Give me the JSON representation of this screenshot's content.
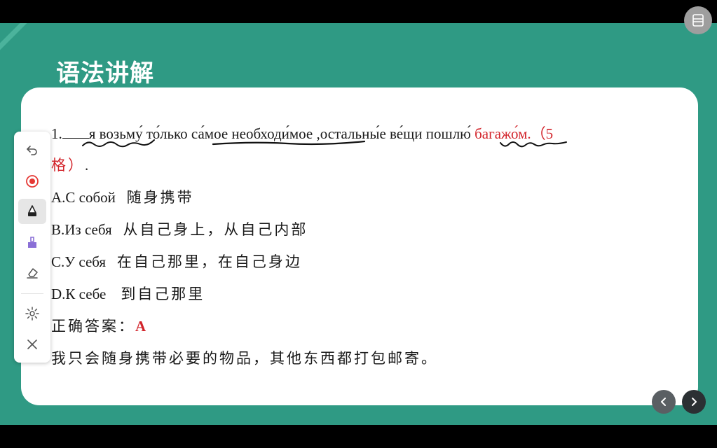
{
  "slide": {
    "title": "语法讲解",
    "question": {
      "number": "1.",
      "text_black": "я возьму́ то́лько са́мое необходи́мое ,остальны́е ве́щи пошлю́",
      "text_red": "багажо́м.（5",
      "text_red_line2": "格）",
      "period": "."
    },
    "options": [
      {
        "label": "A.С собой",
        "meaning": "随身携带"
      },
      {
        "label": "B.Из себя",
        "meaning": "从自己身上，从自己内部"
      },
      {
        "label": "C.У себя",
        "meaning": "在自己那里，在自己身边"
      },
      {
        "label": "D.К себе",
        "meaning": "到自己那里"
      }
    ],
    "answer": {
      "label": "正确答案：",
      "value": "A"
    },
    "translation": "我只会随身携带必要的物品，其他东西都打包邮寄。"
  },
  "toolbar": {
    "items": [
      {
        "name": "undo-icon",
        "interactable": true
      },
      {
        "name": "laser-pointer-icon",
        "interactable": true
      },
      {
        "name": "pen-icon",
        "interactable": true,
        "active": true
      },
      {
        "name": "highlighter-icon",
        "interactable": true
      },
      {
        "name": "eraser-icon",
        "interactable": true
      },
      {
        "name": "settings-icon",
        "interactable": true
      },
      {
        "name": "close-icon",
        "interactable": true
      }
    ]
  },
  "colors": {
    "background": "#2f9a84",
    "answer_red": "#d2232a",
    "laser_red": "#e53935",
    "highlighter_purple": "#8a6fd6"
  }
}
